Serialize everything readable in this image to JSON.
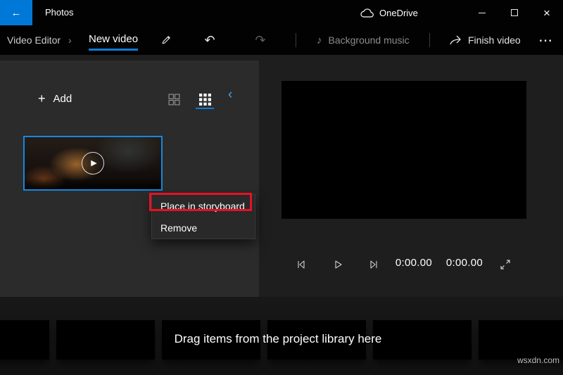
{
  "window": {
    "app_title": "Photos",
    "onedrive_label": "OneDrive"
  },
  "icons": {
    "back_arrow": "←",
    "close": "×",
    "breadcrumb_chevron": "›",
    "undo": "↶",
    "redo": "↷",
    "music_note": "♪",
    "more_ellipsis": "⋯",
    "collapse_chevron": "‹",
    "add_plus": "+",
    "play_triangle": "▶"
  },
  "toolbar": {
    "breadcrumb": "Video Editor",
    "project_title": "New video",
    "background_music_label": "Background music",
    "finish_video_label": "Finish video"
  },
  "library": {
    "add_label": "Add"
  },
  "context_menu": {
    "items": [
      {
        "label": "Place in storyboard",
        "highlighted": true
      },
      {
        "label": "Remove",
        "highlighted": false
      }
    ]
  },
  "player": {
    "elapsed_time": "0:00.00",
    "total_time": "0:00.00"
  },
  "storyboard": {
    "hint_text": "Drag items from the project library here"
  },
  "watermark": "wsxdn.com",
  "colors": {
    "accent_blue": "#0078d7",
    "selection_blue": "#1588e0",
    "annotation_red": "#e81123"
  }
}
